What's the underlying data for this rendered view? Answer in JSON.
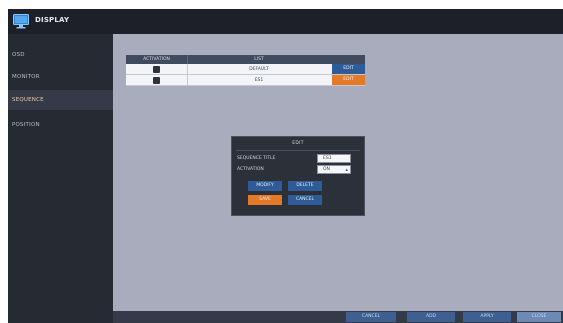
{
  "header": {
    "title": "DISPLAY",
    "icon": "monitor-icon"
  },
  "sidebar": {
    "items": [
      {
        "label": "OSD",
        "active": false
      },
      {
        "label": "MONITOR",
        "active": false
      },
      {
        "label": "SEQUENCE",
        "active": true
      },
      {
        "label": "POSITION",
        "active": false
      }
    ]
  },
  "table": {
    "columns": [
      "ACTIVATION",
      "LIST"
    ],
    "rows": [
      {
        "activation": true,
        "list": "DEFAULT",
        "button": "EDIT",
        "button_color": "#2d5c98"
      },
      {
        "activation": true,
        "list": "ES1",
        "button": "EDIT",
        "button_color": "#e47a27"
      }
    ]
  },
  "dialog": {
    "title": "EDIT",
    "fields": [
      {
        "label": "SEQUENCE TITLE",
        "value": "ES1"
      },
      {
        "label": "ACTIVATION",
        "value": "ON"
      }
    ],
    "buttons": [
      {
        "label": "MODIFY"
      },
      {
        "label": "DELETE"
      },
      {
        "label": "SAVE"
      },
      {
        "label": "CANCEL"
      }
    ]
  },
  "footer": {
    "buttons": [
      {
        "label": "CANCEL"
      },
      {
        "label": "ADD"
      },
      {
        "label": "APPLY"
      },
      {
        "label": "CLOSE"
      }
    ]
  },
  "colors": {
    "accent_orange": "#e47a27",
    "accent_blue": "#2d5c98",
    "content_bg": "#a8acbc",
    "chrome_bg": "#262a33"
  }
}
